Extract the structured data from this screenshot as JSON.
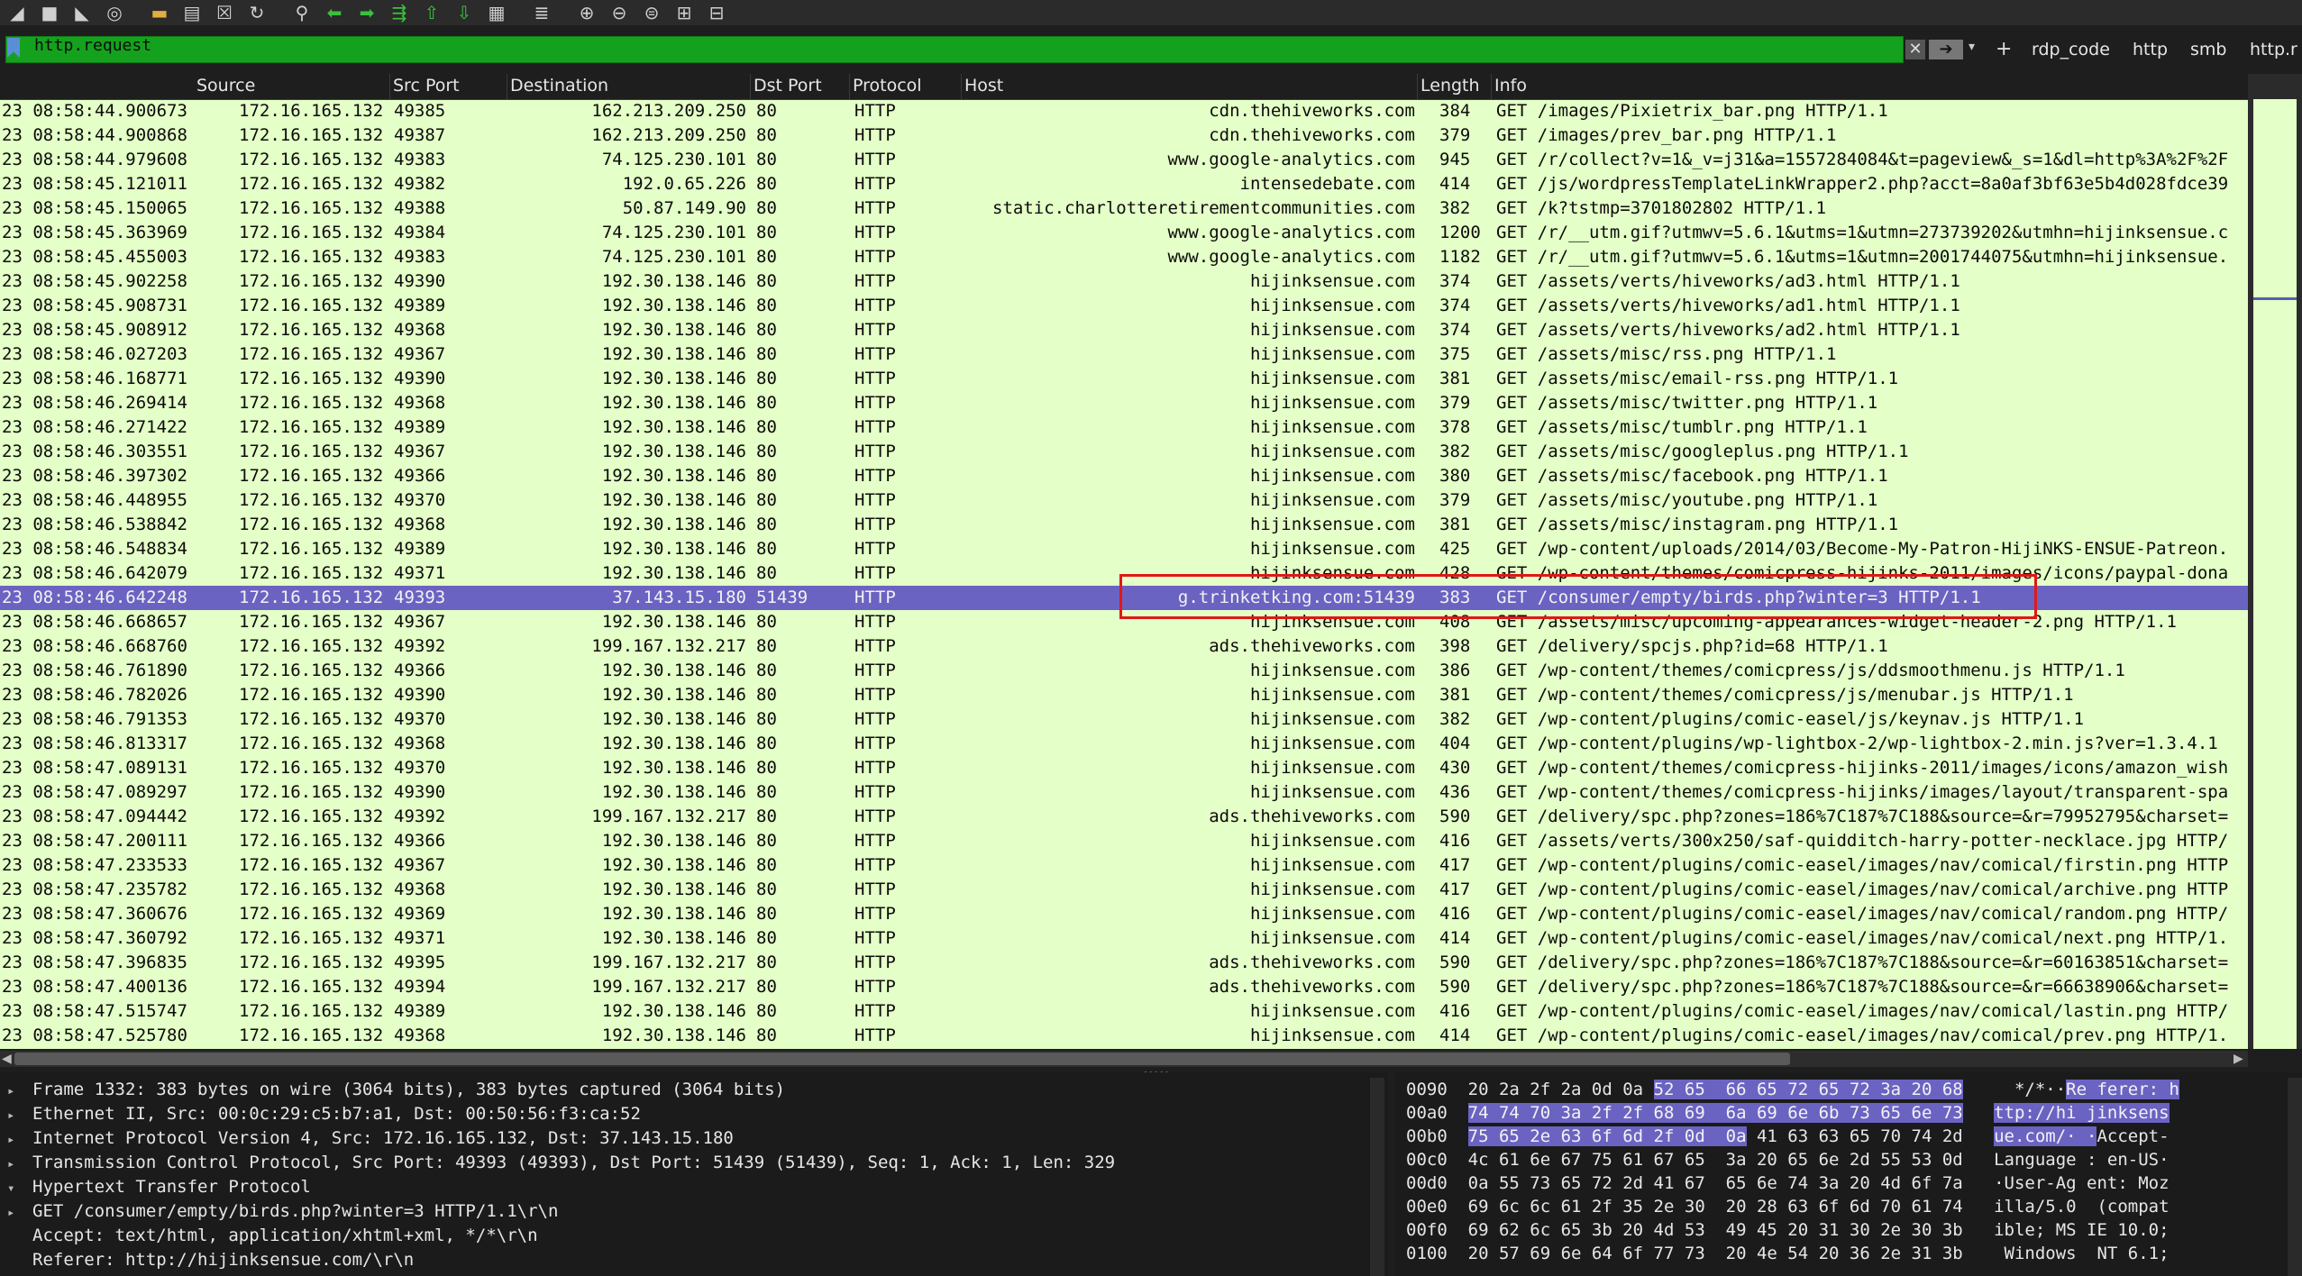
{
  "toolbar": {
    "icons": [
      "shark-fin-icon",
      "stop-icon",
      "restart-icon",
      "options-icon",
      "open-file-icon",
      "save-icon",
      "close-file-icon",
      "reload-icon",
      "find-icon",
      "back-icon",
      "forward-icon",
      "go-to-packet-icon",
      "first-packet-icon",
      "last-packet-icon",
      "autoscroll-icon",
      "colorize-icon",
      "zoom-in-icon",
      "zoom-out-icon",
      "normal-size-icon",
      "resize-columns-icon",
      "layout-icon"
    ]
  },
  "filter": {
    "value": "http.request",
    "buttons": [
      "rdp_code",
      "http",
      "smb",
      "http.r"
    ]
  },
  "columns": {
    "source": "Source",
    "src_port": "Src Port",
    "destination": "Destination",
    "dst_port": "Dst Port",
    "protocol": "Protocol",
    "host": "Host",
    "length": "Length",
    "info": "Info"
  },
  "packets": [
    {
      "time": "23 08:58:44.900673",
      "src": "172.16.165.132",
      "sport": "49385",
      "dst": "162.213.209.250",
      "dport": "80",
      "proto": "HTTP",
      "host": "cdn.thehiveworks.com",
      "len": "384",
      "info": "GET /images/Pixietrix_bar.png HTTP/1.1"
    },
    {
      "time": "23 08:58:44.900868",
      "src": "172.16.165.132",
      "sport": "49387",
      "dst": "162.213.209.250",
      "dport": "80",
      "proto": "HTTP",
      "host": "cdn.thehiveworks.com",
      "len": "379",
      "info": "GET /images/prev_bar.png HTTP/1.1"
    },
    {
      "time": "23 08:58:44.979608",
      "src": "172.16.165.132",
      "sport": "49383",
      "dst": "74.125.230.101",
      "dport": "80",
      "proto": "HTTP",
      "host": "www.google-analytics.com",
      "len": "945",
      "info": "GET /r/collect?v=1&_v=j31&a=1557284084&t=pageview&_s=1&dl=http%3A%2F%2F"
    },
    {
      "time": "23 08:58:45.121011",
      "src": "172.16.165.132",
      "sport": "49382",
      "dst": "192.0.65.226",
      "dport": "80",
      "proto": "HTTP",
      "host": "intensedebate.com",
      "len": "414",
      "info": "GET /js/wordpressTemplateLinkWrapper2.php?acct=8a0af3bf63e5b4d028fdce39"
    },
    {
      "time": "23 08:58:45.150065",
      "src": "172.16.165.132",
      "sport": "49388",
      "dst": "50.87.149.90",
      "dport": "80",
      "proto": "HTTP",
      "host": "static.charlotteretirementcommunities.com",
      "len": "382",
      "info": "GET /k?tstmp=3701802802 HTTP/1.1"
    },
    {
      "time": "23 08:58:45.363969",
      "src": "172.16.165.132",
      "sport": "49384",
      "dst": "74.125.230.101",
      "dport": "80",
      "proto": "HTTP",
      "host": "www.google-analytics.com",
      "len": "1200",
      "info": "GET /r/__utm.gif?utmwv=5.6.1&utms=1&utmn=273739202&utmhn=hijinksensue.c"
    },
    {
      "time": "23 08:58:45.455003",
      "src": "172.16.165.132",
      "sport": "49383",
      "dst": "74.125.230.101",
      "dport": "80",
      "proto": "HTTP",
      "host": "www.google-analytics.com",
      "len": "1182",
      "info": "GET /r/__utm.gif?utmwv=5.6.1&utms=1&utmn=2001744075&utmhn=hijinksensue."
    },
    {
      "time": "23 08:58:45.902258",
      "src": "172.16.165.132",
      "sport": "49390",
      "dst": "192.30.138.146",
      "dport": "80",
      "proto": "HTTP",
      "host": "hijinksensue.com",
      "len": "374",
      "info": "GET /assets/verts/hiveworks/ad3.html HTTP/1.1"
    },
    {
      "time": "23 08:58:45.908731",
      "src": "172.16.165.132",
      "sport": "49389",
      "dst": "192.30.138.146",
      "dport": "80",
      "proto": "HTTP",
      "host": "hijinksensue.com",
      "len": "374",
      "info": "GET /assets/verts/hiveworks/ad1.html HTTP/1.1"
    },
    {
      "time": "23 08:58:45.908912",
      "src": "172.16.165.132",
      "sport": "49368",
      "dst": "192.30.138.146",
      "dport": "80",
      "proto": "HTTP",
      "host": "hijinksensue.com",
      "len": "374",
      "info": "GET /assets/verts/hiveworks/ad2.html HTTP/1.1"
    },
    {
      "time": "23 08:58:46.027203",
      "src": "172.16.165.132",
      "sport": "49367",
      "dst": "192.30.138.146",
      "dport": "80",
      "proto": "HTTP",
      "host": "hijinksensue.com",
      "len": "375",
      "info": "GET /assets/misc/rss.png HTTP/1.1"
    },
    {
      "time": "23 08:58:46.168771",
      "src": "172.16.165.132",
      "sport": "49390",
      "dst": "192.30.138.146",
      "dport": "80",
      "proto": "HTTP",
      "host": "hijinksensue.com",
      "len": "381",
      "info": "GET /assets/misc/email-rss.png HTTP/1.1"
    },
    {
      "time": "23 08:58:46.269414",
      "src": "172.16.165.132",
      "sport": "49368",
      "dst": "192.30.138.146",
      "dport": "80",
      "proto": "HTTP",
      "host": "hijinksensue.com",
      "len": "379",
      "info": "GET /assets/misc/twitter.png HTTP/1.1"
    },
    {
      "time": "23 08:58:46.271422",
      "src": "172.16.165.132",
      "sport": "49389",
      "dst": "192.30.138.146",
      "dport": "80",
      "proto": "HTTP",
      "host": "hijinksensue.com",
      "len": "378",
      "info": "GET /assets/misc/tumblr.png HTTP/1.1"
    },
    {
      "time": "23 08:58:46.303551",
      "src": "172.16.165.132",
      "sport": "49367",
      "dst": "192.30.138.146",
      "dport": "80",
      "proto": "HTTP",
      "host": "hijinksensue.com",
      "len": "382",
      "info": "GET /assets/misc/googleplus.png HTTP/1.1"
    },
    {
      "time": "23 08:58:46.397302",
      "src": "172.16.165.132",
      "sport": "49366",
      "dst": "192.30.138.146",
      "dport": "80",
      "proto": "HTTP",
      "host": "hijinksensue.com",
      "len": "380",
      "info": "GET /assets/misc/facebook.png HTTP/1.1"
    },
    {
      "time": "23 08:58:46.448955",
      "src": "172.16.165.132",
      "sport": "49370",
      "dst": "192.30.138.146",
      "dport": "80",
      "proto": "HTTP",
      "host": "hijinksensue.com",
      "len": "379",
      "info": "GET /assets/misc/youtube.png HTTP/1.1"
    },
    {
      "time": "23 08:58:46.538842",
      "src": "172.16.165.132",
      "sport": "49368",
      "dst": "192.30.138.146",
      "dport": "80",
      "proto": "HTTP",
      "host": "hijinksensue.com",
      "len": "381",
      "info": "GET /assets/misc/instagram.png HTTP/1.1"
    },
    {
      "time": "23 08:58:46.548834",
      "src": "172.16.165.132",
      "sport": "49389",
      "dst": "192.30.138.146",
      "dport": "80",
      "proto": "HTTP",
      "host": "hijinksensue.com",
      "len": "425",
      "info": "GET /wp-content/uploads/2014/03/Become-My-Patron-HijiNKS-ENSUE-Patreon."
    },
    {
      "time": "23 08:58:46.642079",
      "src": "172.16.165.132",
      "sport": "49371",
      "dst": "192.30.138.146",
      "dport": "80",
      "proto": "HTTP",
      "host": "hijinksensue.com",
      "len": "428",
      "info": "GET /wp-content/themes/comicpress-hijinks-2011/images/icons/paypal-dona"
    },
    {
      "time": "23 08:58:46.642248",
      "src": "172.16.165.132",
      "sport": "49393",
      "dst": "37.143.15.180",
      "dport": "51439",
      "proto": "HTTP",
      "host": "g.trinketking.com:51439",
      "len": "383",
      "info": "GET /consumer/empty/birds.php?winter=3 HTTP/1.1",
      "selected": true
    },
    {
      "time": "23 08:58:46.668657",
      "src": "172.16.165.132",
      "sport": "49367",
      "dst": "192.30.138.146",
      "dport": "80",
      "proto": "HTTP",
      "host": "hijinksensue.com",
      "len": "408",
      "info": "GET /assets/misc/upcoming-appearances-widget-header-2.png HTTP/1.1"
    },
    {
      "time": "23 08:58:46.668760",
      "src": "172.16.165.132",
      "sport": "49392",
      "dst": "199.167.132.217",
      "dport": "80",
      "proto": "HTTP",
      "host": "ads.thehiveworks.com",
      "len": "398",
      "info": "GET /delivery/spcjs.php?id=68 HTTP/1.1"
    },
    {
      "time": "23 08:58:46.761890",
      "src": "172.16.165.132",
      "sport": "49366",
      "dst": "192.30.138.146",
      "dport": "80",
      "proto": "HTTP",
      "host": "hijinksensue.com",
      "len": "386",
      "info": "GET /wp-content/themes/comicpress/js/ddsmoothmenu.js HTTP/1.1"
    },
    {
      "time": "23 08:58:46.782026",
      "src": "172.16.165.132",
      "sport": "49390",
      "dst": "192.30.138.146",
      "dport": "80",
      "proto": "HTTP",
      "host": "hijinksensue.com",
      "len": "381",
      "info": "GET /wp-content/themes/comicpress/js/menubar.js HTTP/1.1"
    },
    {
      "time": "23 08:58:46.791353",
      "src": "172.16.165.132",
      "sport": "49370",
      "dst": "192.30.138.146",
      "dport": "80",
      "proto": "HTTP",
      "host": "hijinksensue.com",
      "len": "382",
      "info": "GET /wp-content/plugins/comic-easel/js/keynav.js HTTP/1.1"
    },
    {
      "time": "23 08:58:46.813317",
      "src": "172.16.165.132",
      "sport": "49368",
      "dst": "192.30.138.146",
      "dport": "80",
      "proto": "HTTP",
      "host": "hijinksensue.com",
      "len": "404",
      "info": "GET /wp-content/plugins/wp-lightbox-2/wp-lightbox-2.min.js?ver=1.3.4.1"
    },
    {
      "time": "23 08:58:47.089131",
      "src": "172.16.165.132",
      "sport": "49370",
      "dst": "192.30.138.146",
      "dport": "80",
      "proto": "HTTP",
      "host": "hijinksensue.com",
      "len": "430",
      "info": "GET /wp-content/themes/comicpress-hijinks-2011/images/icons/amazon_wish"
    },
    {
      "time": "23 08:58:47.089297",
      "src": "172.16.165.132",
      "sport": "49390",
      "dst": "192.30.138.146",
      "dport": "80",
      "proto": "HTTP",
      "host": "hijinksensue.com",
      "len": "436",
      "info": "GET /wp-content/themes/comicpress-hijinks/images/layout/transparent-spa"
    },
    {
      "time": "23 08:58:47.094442",
      "src": "172.16.165.132",
      "sport": "49392",
      "dst": "199.167.132.217",
      "dport": "80",
      "proto": "HTTP",
      "host": "ads.thehiveworks.com",
      "len": "590",
      "info": "GET /delivery/spc.php?zones=186%7C187%7C188&source=&r=79952795&charset="
    },
    {
      "time": "23 08:58:47.200111",
      "src": "172.16.165.132",
      "sport": "49366",
      "dst": "192.30.138.146",
      "dport": "80",
      "proto": "HTTP",
      "host": "hijinksensue.com",
      "len": "416",
      "info": "GET /assets/verts/300x250/saf-quidditch-harry-potter-necklace.jpg HTTP/"
    },
    {
      "time": "23 08:58:47.233533",
      "src": "172.16.165.132",
      "sport": "49367",
      "dst": "192.30.138.146",
      "dport": "80",
      "proto": "HTTP",
      "host": "hijinksensue.com",
      "len": "417",
      "info": "GET /wp-content/plugins/comic-easel/images/nav/comical/firstin.png HTTP"
    },
    {
      "time": "23 08:58:47.235782",
      "src": "172.16.165.132",
      "sport": "49368",
      "dst": "192.30.138.146",
      "dport": "80",
      "proto": "HTTP",
      "host": "hijinksensue.com",
      "len": "417",
      "info": "GET /wp-content/plugins/comic-easel/images/nav/comical/archive.png HTTP"
    },
    {
      "time": "23 08:58:47.360676",
      "src": "172.16.165.132",
      "sport": "49369",
      "dst": "192.30.138.146",
      "dport": "80",
      "proto": "HTTP",
      "host": "hijinksensue.com",
      "len": "416",
      "info": "GET /wp-content/plugins/comic-easel/images/nav/comical/random.png HTTP/"
    },
    {
      "time": "23 08:58:47.360792",
      "src": "172.16.165.132",
      "sport": "49371",
      "dst": "192.30.138.146",
      "dport": "80",
      "proto": "HTTP",
      "host": "hijinksensue.com",
      "len": "414",
      "info": "GET /wp-content/plugins/comic-easel/images/nav/comical/next.png HTTP/1."
    },
    {
      "time": "23 08:58:47.396835",
      "src": "172.16.165.132",
      "sport": "49395",
      "dst": "199.167.132.217",
      "dport": "80",
      "proto": "HTTP",
      "host": "ads.thehiveworks.com",
      "len": "590",
      "info": "GET /delivery/spc.php?zones=186%7C187%7C188&source=&r=60163851&charset="
    },
    {
      "time": "23 08:58:47.400136",
      "src": "172.16.165.132",
      "sport": "49394",
      "dst": "199.167.132.217",
      "dport": "80",
      "proto": "HTTP",
      "host": "ads.thehiveworks.com",
      "len": "590",
      "info": "GET /delivery/spc.php?zones=186%7C187%7C188&source=&r=66638906&charset="
    },
    {
      "time": "23 08:58:47.515747",
      "src": "172.16.165.132",
      "sport": "49389",
      "dst": "192.30.138.146",
      "dport": "80",
      "proto": "HTTP",
      "host": "hijinksensue.com",
      "len": "416",
      "info": "GET /wp-content/plugins/comic-easel/images/nav/comical/lastin.png HTTP/"
    },
    {
      "time": "23 08:58:47.525780",
      "src": "172.16.165.132",
      "sport": "49368",
      "dst": "192.30.138.146",
      "dport": "80",
      "proto": "HTTP",
      "host": "hijinksensue.com",
      "len": "414",
      "info": "GET /wp-content/plugins/comic-easel/images/nav/comical/prev.png HTTP/1."
    }
  ],
  "details": [
    {
      "twisty": "▸",
      "text": "Frame 1332: 383 bytes on wire (3064 bits), 383 bytes captured (3064 bits)"
    },
    {
      "twisty": "▸",
      "text": "Ethernet II, Src: 00:0c:29:c5:b7:a1, Dst: 00:50:56:f3:ca:52"
    },
    {
      "twisty": "▸",
      "text": "Internet Protocol Version 4, Src: 172.16.165.132, Dst: 37.143.15.180"
    },
    {
      "twisty": "▸",
      "text": "Transmission Control Protocol, Src Port: 49393 (49393), Dst Port: 51439 (51439), Seq: 1, Ack: 1, Len: 329"
    },
    {
      "twisty": "▾",
      "text": "Hypertext Transfer Protocol"
    },
    {
      "twisty": "  ▸",
      "text": "GET /consumer/empty/birds.php?winter=3 HTTP/1.1\\r\\n"
    },
    {
      "twisty": "   ",
      "text": "Accept: text/html, application/xhtml+xml, */*\\r\\n"
    },
    {
      "twisty": "   ",
      "text": "Referer: http://hijinksensue.com/\\r\\n"
    }
  ],
  "hex": [
    {
      "off": "0090",
      "plain": "20 2a 2f 2a 0d 0a ",
      "hl": "52 65  66 65 72 65 72 3a 20 68",
      "ascii_plain": "  */*··",
      "ascii_hl": "Re ferer: h"
    },
    {
      "off": "00a0",
      "plain": "",
      "hl": "74 74 70 3a 2f 2f 68 69  6a 69 6e 6b 73 65 6e 73",
      "ascii_plain": "",
      "ascii_hl": "ttp://hi jinksens"
    },
    {
      "off": "00b0",
      "plain": "",
      "hl": "75 65 2e 63 6f 6d 2f 0d  0a",
      "tail": " 41 63 63 65 70 74 2d",
      "ascii_plain": "",
      "ascii_hl": "ue.com/· ·",
      "ascii_tail": "Accept-"
    },
    {
      "off": "00c0",
      "plain": "4c 61 6e 67 75 61 67 65  3a 20 65 6e 2d 55 53 0d",
      "hl": "",
      "ascii_plain": "Language : en-US·",
      "ascii_hl": ""
    },
    {
      "off": "00d0",
      "plain": "0a 55 73 65 72 2d 41 67  65 6e 74 3a 20 4d 6f 7a",
      "hl": "",
      "ascii_plain": "·User-Ag ent: Moz",
      "ascii_hl": ""
    },
    {
      "off": "00e0",
      "plain": "69 6c 6c 61 2f 35 2e 30  20 28 63 6f 6d 70 61 74",
      "hl": "",
      "ascii_plain": "illa/5.0  (compat",
      "ascii_hl": ""
    },
    {
      "off": "00f0",
      "plain": "69 62 6c 65 3b 20 4d 53  49 45 20 31 30 2e 30 3b",
      "hl": "",
      "ascii_plain": "ible; MS IE 10.0;",
      "ascii_hl": ""
    },
    {
      "off": "0100",
      "plain": "20 57 69 6e 64 6f 77 73  20 4e 54 20 36 2e 31 3b",
      "hl": "",
      "ascii_plain": " Windows  NT 6.1;",
      "ascii_hl": ""
    }
  ],
  "colors": {
    "list_bg": "#e4ffc7",
    "selected_bg": "#6b63c2",
    "filter_bg": "#14a21e",
    "annotation": "#e01818"
  }
}
